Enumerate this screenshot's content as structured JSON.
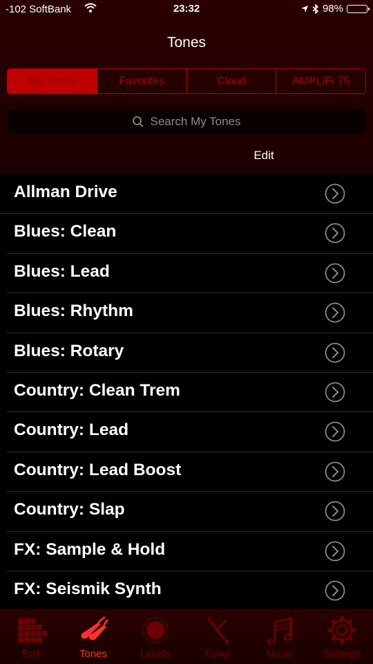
{
  "status_bar": {
    "carrier": "-102 SoftBank",
    "time": "23:32",
    "battery": "98%",
    "battery_level": 0.98
  },
  "nav": {
    "title": "Tones"
  },
  "segments": [
    {
      "label": "My Tones",
      "active": true
    },
    {
      "label": "Favorites",
      "active": false
    },
    {
      "label": "Cloud",
      "active": false
    },
    {
      "label": "AMPLIFi 75",
      "active": false
    }
  ],
  "search": {
    "placeholder": "Search My Tones"
  },
  "edit_label": "Edit",
  "tones": [
    "Allman Drive",
    "Blues: Clean",
    "Blues: Lead",
    "Blues: Rhythm",
    "Blues: Rotary",
    "Country: Clean Trem",
    "Country: Lead",
    "Country: Lead Boost",
    "Country: Slap",
    "FX: Sample & Hold",
    "FX: Seismik Synth"
  ],
  "tabs": [
    {
      "label": "Edit",
      "icon": "grid-icon",
      "active": false
    },
    {
      "label": "Tones",
      "icon": "guitars-icon",
      "active": true
    },
    {
      "label": "Levels",
      "icon": "knob-icon",
      "active": false
    },
    {
      "label": "Tuner",
      "icon": "tuning-fork-icon",
      "active": false
    },
    {
      "label": "Music",
      "icon": "music-note-icon",
      "active": false
    },
    {
      "label": "Settings",
      "icon": "gear-icon",
      "active": false
    }
  ],
  "colors": {
    "accent": "#c00000",
    "active_tab": "#ff3030",
    "inactive_tab": "#6d0000",
    "header_bg": "#2a0000"
  }
}
